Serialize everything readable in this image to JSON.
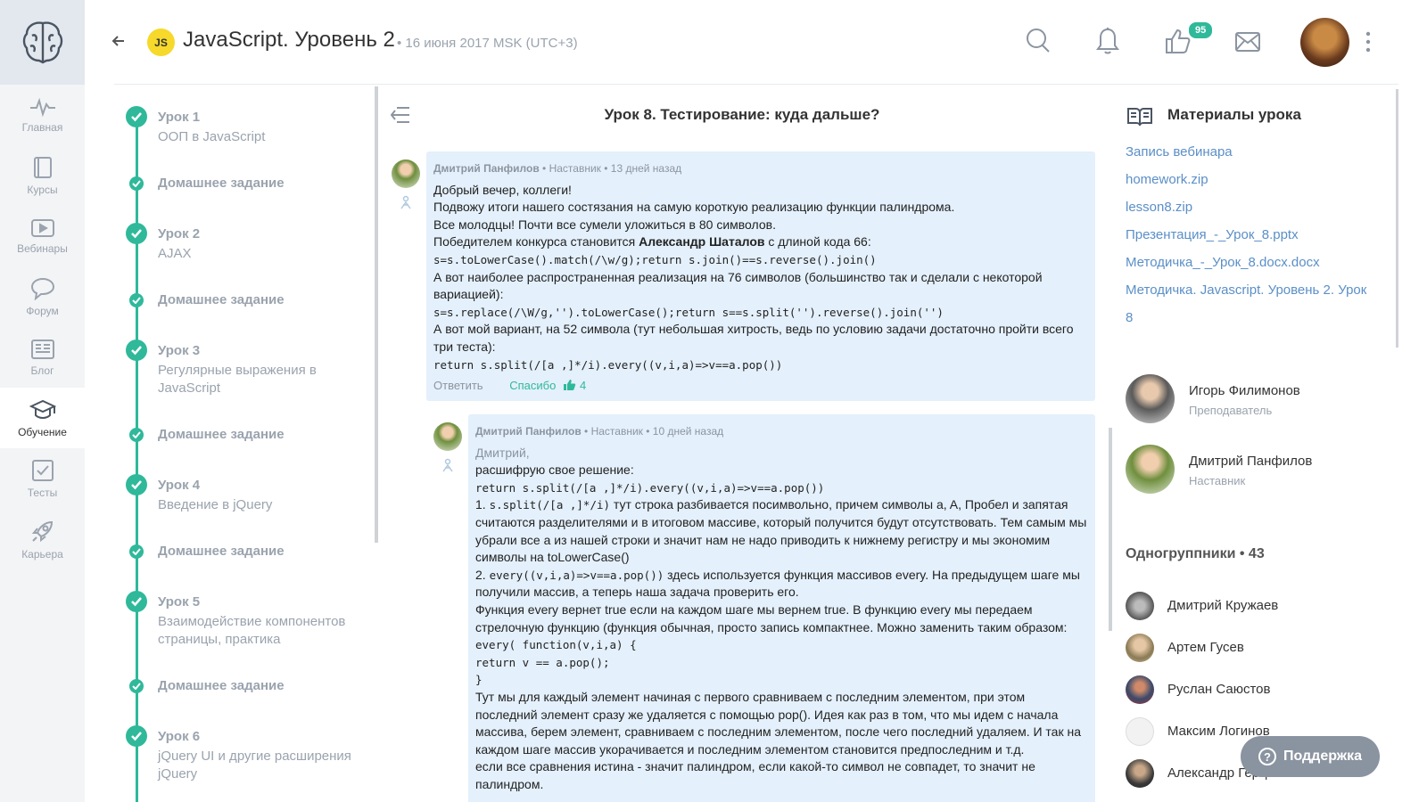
{
  "nav": {
    "items": [
      {
        "label": "Главная",
        "icon": "pulse-icon"
      },
      {
        "label": "Курсы",
        "icon": "book-icon"
      },
      {
        "label": "Вебинары",
        "icon": "play-icon"
      },
      {
        "label": "Форум",
        "icon": "chat-icon"
      },
      {
        "label": "Блог",
        "icon": "newspaper-icon"
      },
      {
        "label": "Обучение",
        "icon": "graduation-cap-icon"
      },
      {
        "label": "Тесты",
        "icon": "checkbox-icon"
      },
      {
        "label": "Карьера",
        "icon": "rocket-icon"
      }
    ],
    "active": "Обучение"
  },
  "header": {
    "badge": "JS",
    "title": "JavaScript. Уровень 2",
    "date": "• 16 июня 2017 MSK (UTC+3)",
    "likes_count": "95"
  },
  "lessons": [
    {
      "num": "Урок 1",
      "name": "ООП в JavaScript"
    },
    {
      "hw": "Домашнее задание"
    },
    {
      "num": "Урок 2",
      "name": "AJAX"
    },
    {
      "hw": "Домашнее задание"
    },
    {
      "num": "Урок 3",
      "name": "Регулярные выражения в JavaScript"
    },
    {
      "hw": "Домашнее задание"
    },
    {
      "num": "Урок 4",
      "name": "Введение в jQuery"
    },
    {
      "hw": "Домашнее задание"
    },
    {
      "num": "Урок 5",
      "name": "Взаимодействие компонентов страницы, практика"
    },
    {
      "hw": "Домашнее задание"
    },
    {
      "num": "Урок 6",
      "name": "jQuery UI и другие расширения jQuery"
    }
  ],
  "main": {
    "title": "Урок 8. Тестирование: куда дальше?",
    "comment1": {
      "author": "Дмитрий Панфилов",
      "meta": "• Наставник • 13 дней назад",
      "l1": "Добрый вечер, коллеги!",
      "l2": "Подвожу итоги нашего состязания на самую короткую реализацию функции палиндрома.",
      "l3": "Все молодцы! Почти все сумели уложиться в 80 символов.",
      "l4a": "Победителем конкурса становится ",
      "l4b": "Александр Шаталов",
      "l4c": " с длиной кода 66:",
      "code1": "s=s.toLowerCase().match(/\\w/g);return s.join()==s.reverse().join()",
      "l5": "А вот наиболее распространенная реализация на 76 символов (большинство так и сделали с некоторой вариацией):",
      "code2": "s=s.replace(/\\W/g,'').toLowerCase();return s==s.split('').reverse().join('')",
      "l6": "А вот мой вариант, на 52 символа (тут небольшая хитрость, ведь по условию задачи достаточно пройти всего три теста):",
      "code3": "return s.split(/[a ,]*/i).every((v,i,a)=>v==a.pop())",
      "reply": "Ответить",
      "thanks": "Спасибо",
      "thanks_count": "4"
    },
    "comment2": {
      "author": "Дмитрий Панфилов",
      "meta": "• Наставник • 10 дней назад",
      "mention": "Дмитрий,",
      "l1": "расшифрую свое решение:",
      "code1": "return s.split(/[a ,]*/i).every((v,i,a)=>v==a.pop())",
      "p1a": "1. ",
      "p1code": "s.split(/[a ,]*/i)",
      "p1b": " тут строка разбивается посимвольно, причем символы a, A, Пробел и запятая считаются разделителями и в итоговом массиве, который получится будут отсутствовать. Тем самым мы убрали все а из нашей строки и значит нам не надо приводить к нижнему регистру и мы экономим символы на toLowerCase()",
      "p2a": "2. ",
      "p2code": "every((v,i,a)=>v==a.pop())",
      "p2b": " здесь используется функция массивов every. На предыдущем шаге мы получили массив, а теперь наша задача проверить его.",
      "p3": "Функция every вернет true если на каждом шаге мы вернем true. В функцию every мы передаем стрелочную функцию (функция обычная, просто запись компактнее. Можно заменить таким образом:",
      "code2": "every( function(v,i,a) {",
      "code3": "return v == a.pop();",
      "code4": "}",
      "p4": "Тут мы для каждый элемент начиная с первого сравниваем с последним элементом, при этом последний элемент сразу же удаляется с помощью pop(). Идея как раз в том, что мы идем с начала массива, берем элемент, сравниваем с последним элементом, после чего последний удаляем. И так на каждом шаге массив укорачивается и последним элементом становится предпоследним и т.д.",
      "p5": "если все сравнения истина - значит палиндром, если какой-то символ не совпадет, то значит не палиндром."
    }
  },
  "materials": {
    "title": "Материалы урока",
    "links": [
      "Запись вебинара",
      "homework.zip",
      "lesson8.zip",
      "Презентация_-_Урок_8.pptx",
      "Методичка_-_Урок_8.docx.docx",
      "Методичка. Javascript. Уровень 2. Урок 8"
    ]
  },
  "staff": [
    {
      "name": "Игорь Филимонов",
      "role": "Преподаватель"
    },
    {
      "name": "Дмитрий Панфилов",
      "role": "Наставник"
    }
  ],
  "classmates": {
    "title": "Одногруппники • 43",
    "list": [
      "Дмитрий Кружаев",
      "Артем Гусев",
      "Руслан Саюстов",
      "Максим Логинов",
      "Александр Герцин"
    ]
  },
  "support": {
    "label": "Поддержка"
  },
  "colors": {
    "accent": "#2fb99a",
    "link": "#5b8fc7",
    "comment_bg": "#e4f0fb",
    "js_badge": "#f6d92a"
  }
}
